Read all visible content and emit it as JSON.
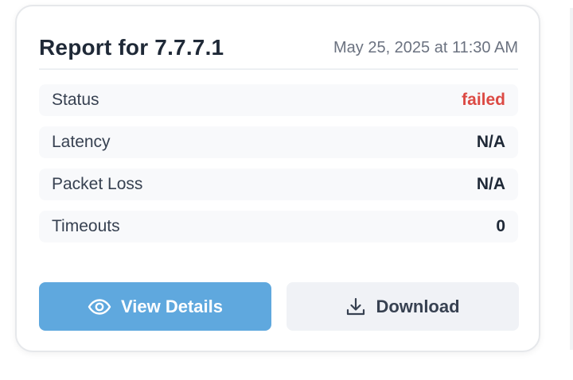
{
  "report": {
    "title": "Report for 7.7.7.1",
    "timestamp": "May 25, 2025 at 11:30 AM"
  },
  "metrics": [
    {
      "label": "Status",
      "value": "failed",
      "value_color": "#dc4a44"
    },
    {
      "label": "Latency",
      "value": "N/A"
    },
    {
      "label": "Packet Loss",
      "value": "N/A"
    },
    {
      "label": "Timeouts",
      "value": "0"
    }
  ],
  "actions": {
    "view_details": {
      "label": "View Details",
      "icon": "eye-icon",
      "color": "#5fa8de"
    },
    "download": {
      "label": "Download",
      "icon": "download-icon",
      "color": "#f0f2f6"
    }
  }
}
